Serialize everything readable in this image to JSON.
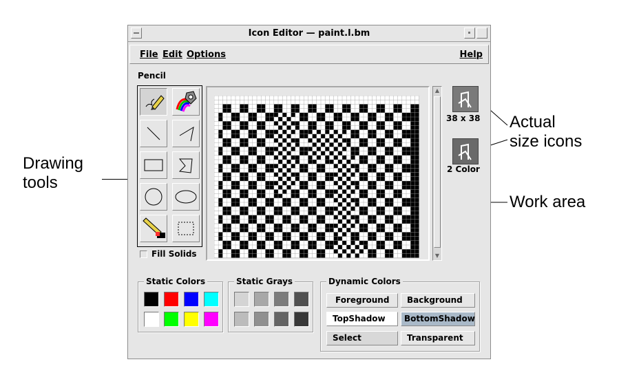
{
  "window": {
    "title": "Icon Editor — paint.l.bm"
  },
  "menubar": {
    "items": [
      "File",
      "Edit",
      "Options"
    ],
    "help": "Help"
  },
  "tool_panel": {
    "current_tool": "Pencil",
    "tools": [
      "pencil",
      "flood-fill",
      "line",
      "polyline",
      "rectangle",
      "polygon",
      "circle",
      "ellipse",
      "eraser",
      "select-area"
    ],
    "fill_solids_label": "Fill Solids",
    "fill_solids_checked": false
  },
  "previews": {
    "actual_size_label": "38 x 38",
    "two_color_label": "2 Color"
  },
  "static_colors": {
    "title": "Static Colors",
    "colors": [
      "#000000",
      "#ff0000",
      "#0000ff",
      "#00ffff",
      "#ffffff",
      "#00ff00",
      "#ffff00",
      "#ff00ff"
    ]
  },
  "static_grays": {
    "title": "Static Grays",
    "colors": [
      "#d4d4d4",
      "#a8a8a8",
      "#7c7c7c",
      "#505050",
      "#bcbcbc",
      "#909090",
      "#646464",
      "#383838"
    ]
  },
  "dynamic_colors": {
    "title": "Dynamic Colors",
    "buttons": [
      "Foreground",
      "Background",
      "TopShadow",
      "BottomShadow",
      "Select",
      "Transparent"
    ]
  },
  "annotations": {
    "drawing_tools": "Drawing\ntools",
    "actual_size_icons": "Actual\nsize icons",
    "work_area": "Work area"
  },
  "colors": {
    "window_bg": "#e6e6e6",
    "bottom_shadow_button": "#a9b9c8",
    "select_button": "#d8d8d8",
    "topshadow_button": "#ffffff"
  }
}
